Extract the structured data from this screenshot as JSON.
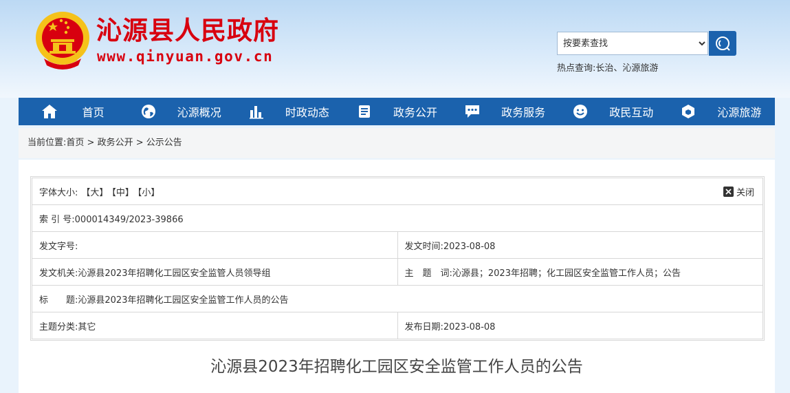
{
  "header": {
    "site_name": "沁源县人民政府",
    "site_url": "www.qinyuan.gov.cn",
    "emblem_icon": "national-emblem-icon",
    "brand_color": "#d8000f"
  },
  "search": {
    "selected": "按要素查找",
    "button_icon": "search-icon"
  },
  "hot": {
    "label": "热点查询:",
    "links": [
      "长治",
      "沁源旅游"
    ],
    "separator": "、"
  },
  "nav": {
    "color": "#1b62ad",
    "items": [
      {
        "label": "首页",
        "icon": "home-icon"
      },
      {
        "label": "沁源概况",
        "icon": "globe-icon"
      },
      {
        "label": "时政动态",
        "icon": "bar-chart-icon"
      },
      {
        "label": "政务公开",
        "icon": "document-icon"
      },
      {
        "label": "政务服务",
        "icon": "chat-icon"
      },
      {
        "label": "政民互动",
        "icon": "smiley-icon"
      },
      {
        "label": "沁源旅游",
        "icon": "cube-icon"
      }
    ]
  },
  "breadcrumb": {
    "label": "当前位置:",
    "items": [
      "首页",
      "政务公开",
      "公示公告"
    ],
    "separator": " > "
  },
  "info": {
    "font_size_label": "字体大小:",
    "font_sizes": [
      "【大】",
      "【中】",
      "【小】"
    ],
    "close_label": "关闭",
    "index_label": "索 引 号:",
    "index_value": "000014349/2023-39866",
    "doc_no_label": "发文字号:",
    "doc_no_value": "",
    "issue_time_label": "发文时间:",
    "issue_time_value": "2023-08-08",
    "issuer_label": "发文机关:",
    "issuer_value": "沁源县2023年招聘化工园区安全监管人员领导组",
    "keywords_label": "主　题　词:",
    "keywords_value": "沁源县；2023年招聘；化工园区安全监管工作人员；公告",
    "title_label": "标　　题:",
    "title_value": "沁源县2023年招聘化工园区安全监管工作人员的公告",
    "category_label": "主题分类:",
    "category_value": "其它",
    "publish_date_label": "发布日期:",
    "publish_date_value": "2023-08-08"
  },
  "article": {
    "title": "沁源县2023年招聘化工园区安全监管工作人员的公告"
  }
}
